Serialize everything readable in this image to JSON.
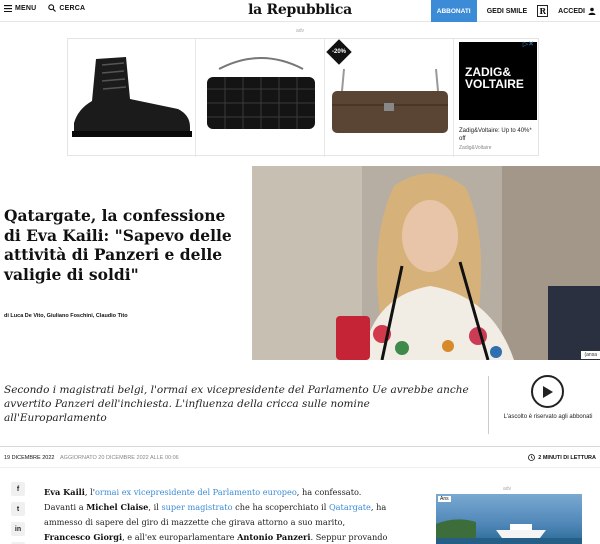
{
  "header": {
    "menu_label": "MENU",
    "search_label": "CERCA",
    "logo": "la Repubblica",
    "subscribe_label": "ABBONATI",
    "gedi_label": "GEDI SMILE",
    "r_label": "R",
    "login_label": "ACCEDI"
  },
  "ad": {
    "label": "adv",
    "badge": "-20%",
    "brand": "ZADIG& VOLTAIRE",
    "caption": "Zadig&Voltaire: Up to 40%* off",
    "sub": "Zadig&Voltaire"
  },
  "article": {
    "title": "Qatargate, la confessione di Eva Kaili: \"Sapevo delle attività di Panzeri e delle valigie di soldi\"",
    "authors": "di Luca De Vito, Giuliano Foschini, Claudio Tito",
    "photo_credit": "(ansa",
    "summary": "Secondo i magistrati belgi, l'ormai ex vicepresidente del Parlamento Ue avrebbe anche avvertito Panzeri dell'inchiesta. L'influenza della cricca sulle nomine all'Europarlamento",
    "listen_label": "L'ascolto è riservato agli abbonati",
    "date": "19 DICEMBRE 2022",
    "updated": "AGGIORNATO 20 DICEMBRE 2022 ALLE 00:06",
    "read_time": "2 MINUTI DI LETTURA"
  },
  "body": {
    "p1_a": "Eva Kaili",
    "p1_b": ", l'",
    "p1_link1": "ormai ex vicepresidente del Parlamento europeo",
    "p1_c": ", ha confessato. Davanti a ",
    "p1_d": "Michel Claise",
    "p1_e": ", il ",
    "p1_link2": "super magistrato",
    "p1_f": " che ha scoperchiato il ",
    "p1_link3": "Qatargate",
    "p1_g": ", ha ammesso di sapere del giro di mazzette che girava attorno a suo marito, ",
    "p1_h": "Francesco Giorgi",
    "p1_i": ", e all'ex europarlamentare ",
    "p1_j": "Antonio Panzeri",
    "p1_k": ". Seppur provando a circoscrivere le sue"
  },
  "social": [
    "f",
    "t",
    "in",
    "✉"
  ],
  "ad2": {
    "label": "adv",
    "tag": "Ans"
  },
  "colors": {
    "accent": "#3b8bd6"
  }
}
